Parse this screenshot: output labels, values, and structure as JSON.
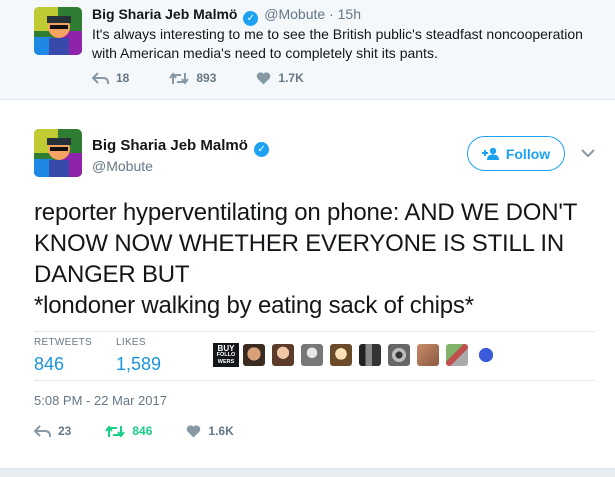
{
  "parent_tweet": {
    "name": "Big Sharia Jeb Malmö",
    "handle": "@Mobute",
    "separator": "·",
    "time": "15h",
    "text": "It's always interesting to me to see the British public's steadfast noncooperation with American media's need to completely shit its pants.",
    "replies": "18",
    "retweets": "893",
    "likes": "1.7K"
  },
  "main_tweet": {
    "name": "Big Sharia Jeb Malmö",
    "handle": "@Mobute",
    "follow_label": "Follow",
    "text": "reporter hyperventilating on phone: AND WE DON'T KNOW NOW WHETHER EVERYONE IS STILL IN DANGER BUT\n*londoner walking by eating sack of chips*",
    "retweets_label": "RETWEETS",
    "retweets_value": "846",
    "likes_label": "LIKES",
    "likes_value": "1,589",
    "timestamp": "5:08 PM - 22 Mar 2017",
    "replies": "23",
    "retweets": "846",
    "likes": "1.6K"
  },
  "colors": {
    "accent": "#1da1f2",
    "retweet_green": "#19cf86",
    "muted": "#657786"
  },
  "icons": {
    "reply": "reply-icon",
    "retweet": "retweet-icon",
    "like": "heart-icon",
    "verified": "verified-badge-icon",
    "follow": "add-user-icon",
    "more": "chevron-down-icon"
  }
}
